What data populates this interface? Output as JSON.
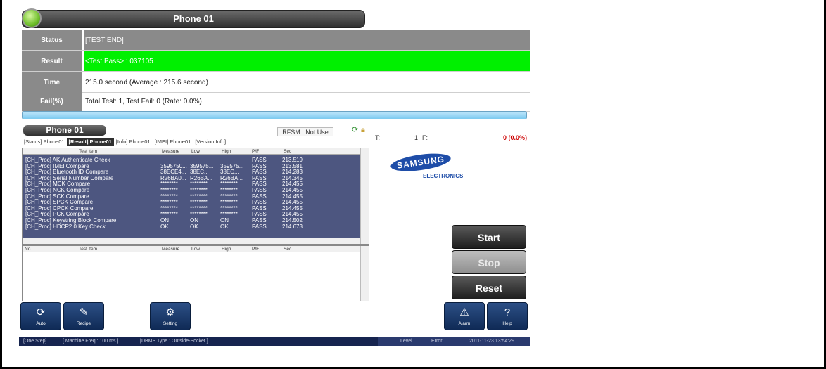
{
  "window": {
    "title": "Phone 01"
  },
  "info": {
    "status_label": "Status",
    "status_value": "[TEST END]",
    "result_label": "Result",
    "result_value": "<Test Pass> : 037105",
    "time_label": "Time",
    "time_value": "215.0 second (Average : 215.6 second)",
    "fail_label": "Fail(%)",
    "fail_value": "Total Test: 1, Test Fail: 0 (Rate: 0.0%)"
  },
  "colors": {
    "result_pass": "#00f000",
    "header_gray": "#8a8a8a",
    "grid_bg": "#4d5680"
  },
  "panel": {
    "title": "Phone 01",
    "rfsm": "RFSM : Not Use",
    "t_label": "T:",
    "t_value": "1",
    "f_label": "F:",
    "f_value": "0 (0.0%)"
  },
  "tabs": [
    "[Status] Phone01",
    "[Result] Phone01",
    "[Info] Phone01",
    "[IMEI] Phone01",
    "[Version Info]"
  ],
  "grid": {
    "headers": [
      "Test item",
      "Measure",
      "Low",
      "High",
      "P/F",
      "Sec"
    ],
    "lower_headers": [
      "No",
      "Test item",
      "Measure",
      "Low",
      "High",
      "P/F",
      "Sec"
    ],
    "rows": [
      {
        "item": "[CH_Proc] AK Authenticate Check",
        "measure": "",
        "low": "",
        "high": "",
        "pf": "PASS",
        "sec": "213.519"
      },
      {
        "item": "[CH_Proc] IMEI Compare",
        "measure": "3595750...",
        "low": "359575...",
        "high": "359575...",
        "pf": "PASS",
        "sec": "213.581"
      },
      {
        "item": "[CH_Proc] Bluetooth ID Compare",
        "measure": "38ECE4...",
        "low": "38EC...",
        "high": "38EC...",
        "pf": "PASS",
        "sec": "214.283"
      },
      {
        "item": "[CH_Proc] Serial Number Compare",
        "measure": "R26BA0...",
        "low": "R26BA...",
        "high": "R26BA...",
        "pf": "PASS",
        "sec": "214.345"
      },
      {
        "item": "[CH_Proc] MCK Compare",
        "measure": "********",
        "low": "********",
        "high": "********",
        "pf": "PASS",
        "sec": "214.455"
      },
      {
        "item": "[CH_Proc] NCK Compare",
        "measure": "********",
        "low": "********",
        "high": "********",
        "pf": "PASS",
        "sec": "214.455"
      },
      {
        "item": "[CH_Proc] SCK Compare",
        "measure": "********",
        "low": "********",
        "high": "********",
        "pf": "PASS",
        "sec": "214.455"
      },
      {
        "item": "[CH_Proc] SPCK Compare",
        "measure": "********",
        "low": "********",
        "high": "********",
        "pf": "PASS",
        "sec": "214.455"
      },
      {
        "item": "[CH_Proc] CPCK Compare",
        "measure": "********",
        "low": "********",
        "high": "********",
        "pf": "PASS",
        "sec": "214.455"
      },
      {
        "item": "[CH_Proc] PCK Compare",
        "measure": "********",
        "low": "********",
        "high": "********",
        "pf": "PASS",
        "sec": "214.455"
      },
      {
        "item": "[CH_Proc] Keystring Block Compare",
        "measure": "ON",
        "low": "ON",
        "high": "ON",
        "pf": "PASS",
        "sec": "214.502"
      },
      {
        "item": "[CH_Proc] HDCP2.0 Key Check",
        "measure": "OK",
        "low": "OK",
        "high": "OK",
        "pf": "PASS",
        "sec": "214.673"
      }
    ]
  },
  "logo": {
    "brand": "SAMSUNG",
    "sub": "ELECTRONICS"
  },
  "buttons": {
    "start": "Start",
    "stop": "Stop",
    "reset": "Reset"
  },
  "toolbar": {
    "auto": "Auto",
    "recipe": "Recipe",
    "setting": "Setting",
    "alarm": "Alarm",
    "help": "Help",
    "auto_icon": "refresh-icon",
    "recipe_icon": "recipe-icon",
    "setting_icon": "gear-icon",
    "alarm_icon": "warning-icon",
    "help_icon": "help-icon"
  },
  "statusbar": {
    "step": "[One Step]",
    "machine_freq": "[ Machine Freq : 100 ms ]",
    "dbms_type": "[DBMS Type : Outside-Socket ]",
    "level": "Level",
    "error": "Error",
    "datetime": "2011-11-23 13:54:29"
  }
}
